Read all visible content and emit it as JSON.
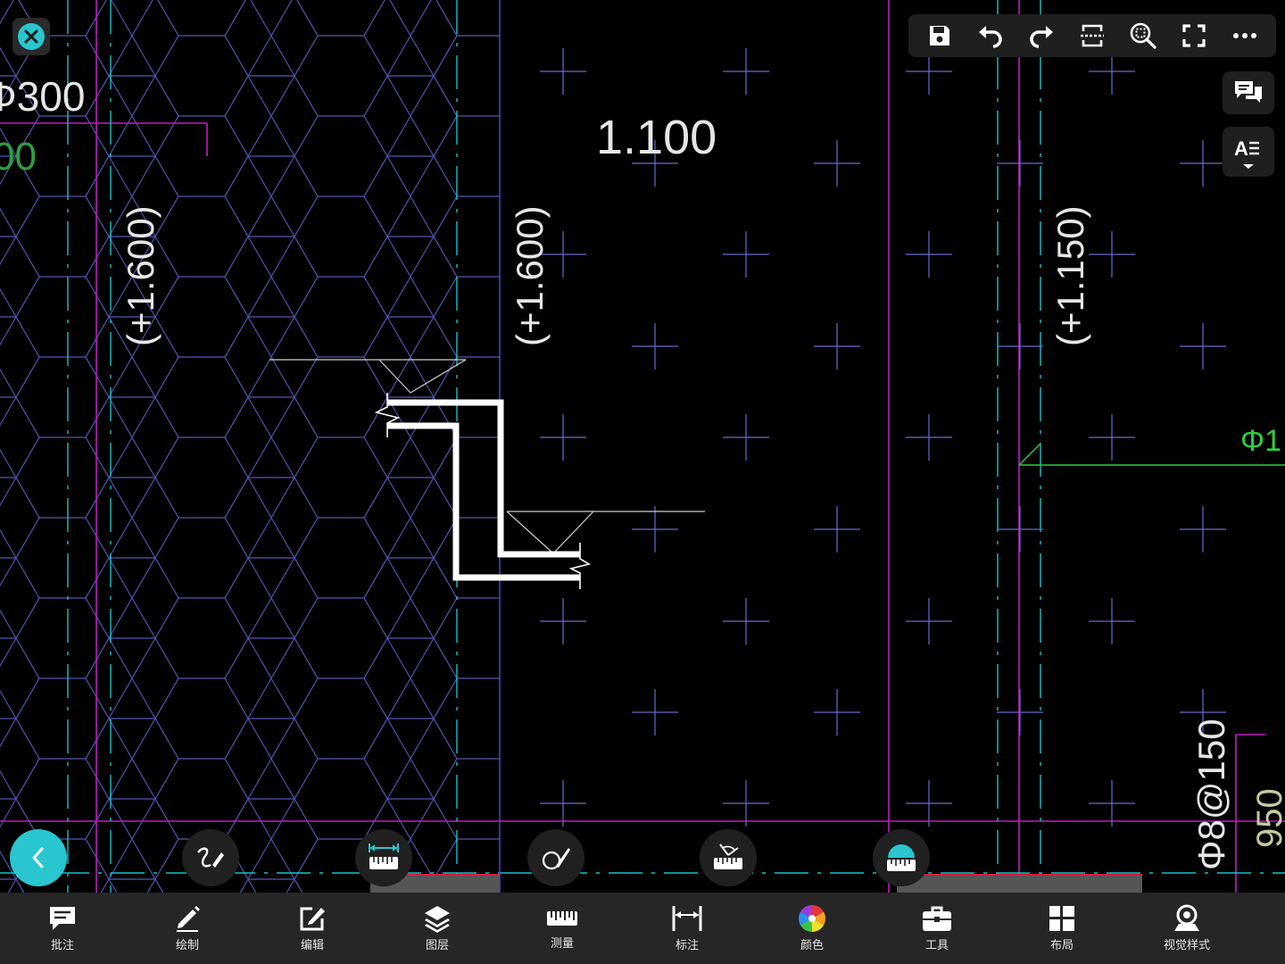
{
  "drawing": {
    "texts": {
      "top_left_spacing": "Φ300",
      "top_left_green": "00",
      "elevation_main": "1.100",
      "elev_left": "(+1.600)",
      "elev_center": "(+1.600)",
      "elev_right": "(+1.150)",
      "rebar_right": "Φ8@150",
      "bottom_right_dim": "950",
      "right_green_mark": "Φ1"
    }
  },
  "top_toolbar": {
    "buttons": [
      {
        "icon": "save-icon"
      },
      {
        "icon": "undo-icon"
      },
      {
        "icon": "redo-icon"
      },
      {
        "icon": "region-select-icon"
      },
      {
        "icon": "zoom-extent-icon"
      },
      {
        "icon": "fullscreen-icon"
      },
      {
        "icon": "more-icon"
      }
    ]
  },
  "side_buttons": [
    {
      "icon": "comments-icon"
    },
    {
      "icon": "text-style-icon"
    }
  ],
  "quick_tools": [
    {
      "icon": "freehand-draw-icon"
    },
    {
      "icon": "linear-measure-icon"
    },
    {
      "icon": "brush-icon"
    },
    {
      "icon": "angle-measure-icon"
    },
    {
      "icon": "area-measure-icon"
    }
  ],
  "bottom_bar": {
    "items": [
      {
        "label": "批注",
        "icon": "annotation-icon"
      },
      {
        "label": "绘制",
        "icon": "pencil-icon"
      },
      {
        "label": "编辑",
        "icon": "edit-icon"
      },
      {
        "label": "图层",
        "icon": "layers-icon"
      },
      {
        "label": "测量",
        "icon": "ruler-icon"
      },
      {
        "label": "标注",
        "icon": "dimension-icon"
      },
      {
        "label": "颜色",
        "icon": "color-wheel-icon"
      },
      {
        "label": "工具",
        "icon": "toolbox-icon"
      },
      {
        "label": "布局",
        "icon": "layout-icon"
      },
      {
        "label": "视觉样式",
        "icon": "visual-style-icon"
      }
    ]
  },
  "colors": {
    "accent": "#29c6cf",
    "canvas": "#000000",
    "toolbar": "#1f1f1f",
    "bottom_bar": "#262626",
    "magenta_line": "#c01bc4",
    "cyan_line": "#17c3c9",
    "hex_pattern": "#5f5fc0"
  }
}
